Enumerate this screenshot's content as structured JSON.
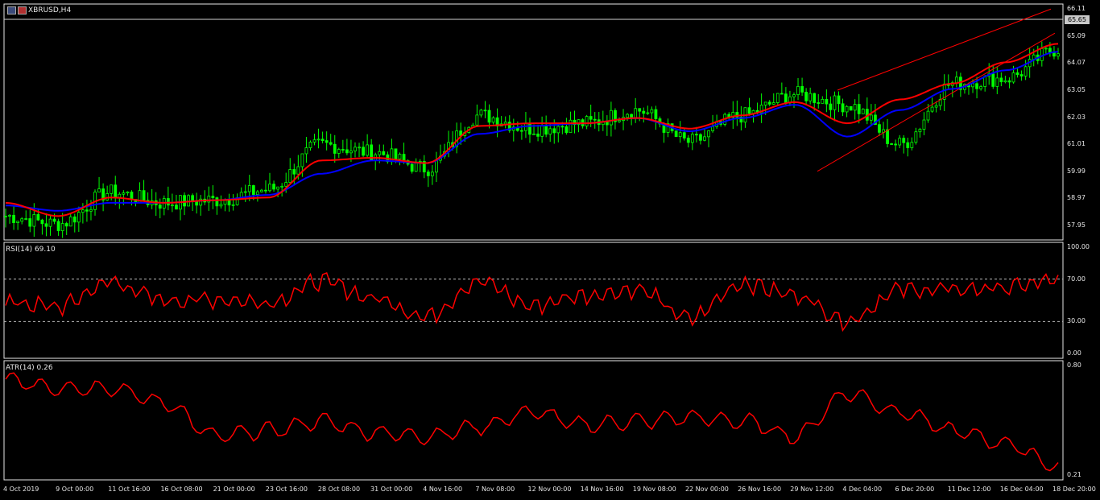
{
  "window": {
    "title": "XBRUSD,H4",
    "current_price": "65.65"
  },
  "colors": {
    "background": "#000000",
    "grid": "#ffffff",
    "candle_up": "#00ff00",
    "ma_fast": "#ff0000",
    "ma_slow": "#0000ff",
    "channel": "#ff0000",
    "rsi": "#ff0000",
    "atr": "#ff0000"
  },
  "price_axis": [
    "66.11",
    "65.09",
    "64.07",
    "63.05",
    "62.03",
    "61.01",
    "59.99",
    "58.97",
    "57.95"
  ],
  "rsi_panel": {
    "label": "RSI(14) 69.10",
    "axis": [
      "100.00",
      "70.00",
      "30.00",
      "0.00"
    ],
    "levels": [
      70,
      30
    ]
  },
  "atr_panel": {
    "label": "ATR(14) 0.26",
    "axis": [
      "0.80",
      "0.21"
    ]
  },
  "time_axis": [
    "4 Oct 2019",
    "9 Oct 00:00",
    "11 Oct 16:00",
    "16 Oct 08:00",
    "21 Oct 00:00",
    "23 Oct 16:00",
    "28 Oct 08:00",
    "31 Oct 00:00",
    "4 Nov 16:00",
    "7 Nov 08:00",
    "12 Nov 00:00",
    "14 Nov 16:00",
    "19 Nov 08:00",
    "22 Nov 00:00",
    "26 Nov 16:00",
    "29 Nov 12:00",
    "4 Dec 04:00",
    "6 Dec 20:00",
    "11 Dec 12:00",
    "16 Dec 04:00",
    "18 Dec 20:00"
  ],
  "chart_data": {
    "type": "line",
    "x": [
      "4 Oct 2019",
      "9 Oct 00:00",
      "11 Oct 16:00",
      "16 Oct 08:00",
      "21 Oct 00:00",
      "23 Oct 16:00",
      "28 Oct 08:00",
      "31 Oct 00:00",
      "4 Nov 16:00",
      "7 Nov 08:00",
      "12 Nov 00:00",
      "14 Nov 16:00",
      "19 Nov 08:00",
      "22 Nov 00:00",
      "26 Nov 16:00",
      "29 Nov 12:00",
      "4 Dec 04:00",
      "6 Dec 20:00",
      "11 Dec 12:00",
      "16 Dec 04:00",
      "18 Dec 20:00"
    ],
    "series": [
      {
        "values": [
          58.3,
          58.0,
          59.2,
          58.8,
          58.9,
          59.3,
          61.0,
          60.7,
          60.1,
          62.1,
          61.6,
          61.8,
          62.3,
          61.1,
          62.1,
          62.9,
          62.5,
          61.0,
          63.3,
          63.5,
          64.6
        ]
      },
      {
        "values": [
          58.8,
          58.3,
          59.0,
          58.8,
          58.9,
          59.0,
          60.4,
          60.5,
          60.3,
          61.7,
          61.8,
          61.8,
          62.0,
          61.6,
          62.1,
          62.6,
          61.8,
          62.7,
          63.3,
          64.1,
          64.8
        ]
      },
      {
        "values": [
          58.7,
          58.5,
          58.8,
          58.8,
          58.9,
          59.1,
          59.9,
          60.4,
          60.3,
          61.4,
          61.7,
          61.8,
          62.0,
          61.5,
          62.0,
          62.5,
          61.3,
          62.3,
          63.1,
          63.8,
          64.5
        ]
      },
      {
        "values": [
          48,
          44,
          67,
          50,
          51,
          48,
          68,
          52,
          35,
          68,
          45,
          55,
          60,
          33,
          66,
          55,
          31,
          60,
          60,
          62,
          69
        ]
      },
      {
        "values": [
          0.72,
          0.68,
          0.68,
          0.6,
          0.42,
          0.45,
          0.5,
          0.44,
          0.42,
          0.47,
          0.55,
          0.48,
          0.5,
          0.52,
          0.5,
          0.42,
          0.65,
          0.55,
          0.45,
          0.38,
          0.26
        ]
      }
    ]
  }
}
